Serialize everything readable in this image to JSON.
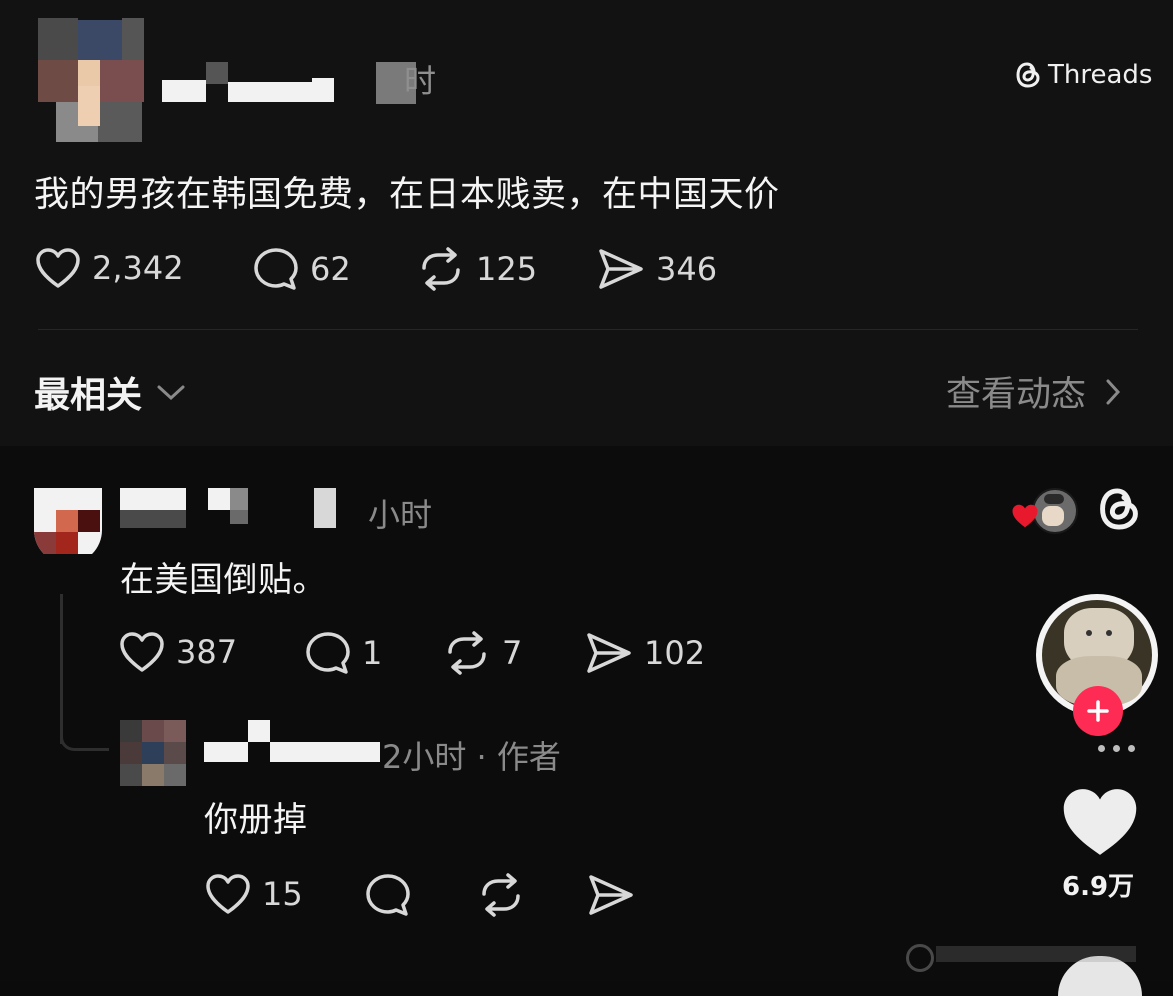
{
  "post": {
    "time_suffix": "时",
    "text": "我的男孩在韩国免费，在日本贱卖，在中国天价",
    "likes": "2,342",
    "replies": "62",
    "reposts": "125",
    "shares": "346"
  },
  "brand": {
    "label": "Threads"
  },
  "sort": {
    "label": "最相关",
    "activity_link": "查看动态"
  },
  "reply1": {
    "time": "小时",
    "text": "在美国倒贴。",
    "likes": "387",
    "replies": "1",
    "reposts": "7",
    "shares": "102"
  },
  "reply2": {
    "meta": "2小时 · 作者",
    "text": "你册掉",
    "likes": "15"
  },
  "side": {
    "like_count": "6.9万"
  },
  "colors": {
    "background": "#0b0b0b",
    "accent_red": "#fe2c55",
    "text_muted": "#8a8a8a"
  }
}
